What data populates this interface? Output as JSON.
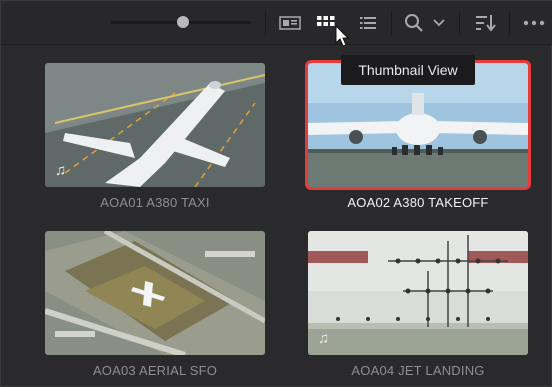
{
  "toolbar": {
    "icons": {
      "metadata_view": "metadata-view-icon",
      "thumbnail_view": "thumbnail-grid-icon",
      "list_view": "list-view-icon",
      "search": "search-icon",
      "search_dropdown": "chevron-down-icon",
      "sort": "sort-icon",
      "more": "more-options-icon"
    },
    "zoom_slider_level": 0.55
  },
  "tooltip": {
    "text": "Thumbnail View"
  },
  "clips": [
    {
      "label": "AOA01 A380 TAXI",
      "selected": false,
      "has_audio": true
    },
    {
      "label": "AOA02 A380 TAKEOFF",
      "selected": true,
      "has_audio": false
    },
    {
      "label": "AOA03 AERIAL SFO",
      "selected": false,
      "has_audio": false
    },
    {
      "label": "AOA04 JET LANDING",
      "selected": false,
      "has_audio": true
    }
  ],
  "colors": {
    "panel_bg": "#2a2a2d",
    "selection": "#e53b3b",
    "label_inactive": "#8f8f93",
    "label_active": "#f2f2f3"
  }
}
